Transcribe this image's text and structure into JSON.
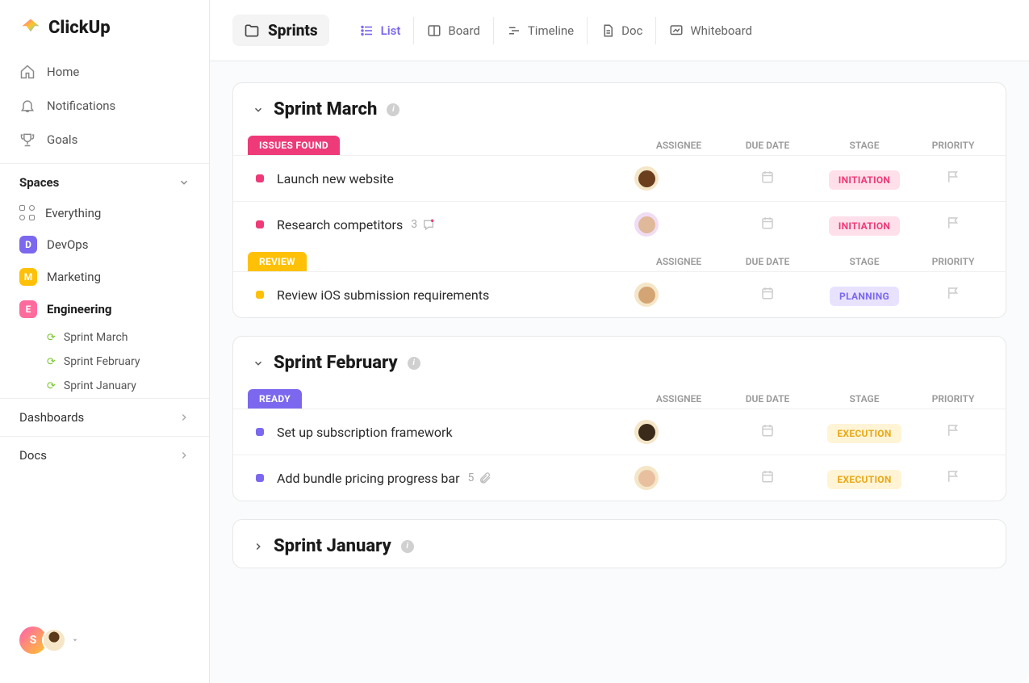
{
  "brand": "ClickUp",
  "nav": {
    "home": "Home",
    "notifications": "Notifications",
    "goals": "Goals"
  },
  "spaces": {
    "header": "Spaces",
    "everything": "Everything",
    "items": [
      {
        "letter": "D",
        "label": "DevOps",
        "color": "#7b68ee"
      },
      {
        "letter": "M",
        "label": "Marketing",
        "color": "#ffc107"
      },
      {
        "letter": "E",
        "label": "Engineering",
        "color": "#ff6b9d"
      }
    ]
  },
  "sprint_links": [
    "Sprint  March",
    "Sprint  February",
    "Sprint January"
  ],
  "sections": {
    "dashboards": "Dashboards",
    "docs": "Docs"
  },
  "user_initial": "S",
  "topbar": {
    "folder": "Sprints",
    "views": [
      "List",
      "Board",
      "Timeline",
      "Doc",
      "Whiteboard"
    ]
  },
  "columns": {
    "assignee": "ASSIGNEE",
    "due": "DUE DATE",
    "stage": "STAGE",
    "priority": "PRIORITY"
  },
  "sprints": [
    {
      "title": "Sprint March",
      "expanded": true,
      "groups": [
        {
          "status": "ISSUES FOUND",
          "status_color": "#ee3a78",
          "task_color": "#ee3a78",
          "tasks": [
            {
              "title": "Launch new website",
              "stage": "INITIATION",
              "stage_bg": "#ffe0ea",
              "stage_color": "#ee3a78",
              "avatar_bg": "#f5e6c8",
              "face": "#6b3e1e"
            },
            {
              "title": "Research competitors",
              "count": "3",
              "has_chat": true,
              "stage": "INITIATION",
              "stage_bg": "#ffe0ea",
              "stage_color": "#ee3a78",
              "avatar_bg": "#f0ddf3",
              "face": "#e0b89a"
            }
          ]
        },
        {
          "status": "REVIEW",
          "status_color": "#ffc107",
          "task_color": "#ffc107",
          "tasks": [
            {
              "title": "Review iOS submission requirements",
              "stage": "PLANNING",
              "stage_bg": "#e8e2ff",
              "stage_color": "#7b68ee",
              "avatar_bg": "#f5e6c8",
              "face": "#d4a574"
            }
          ]
        }
      ]
    },
    {
      "title": "Sprint February",
      "expanded": true,
      "groups": [
        {
          "status": "READY",
          "status_color": "#7b68ee",
          "task_color": "#7b68ee",
          "tasks": [
            {
              "title": "Set up subscription framework",
              "stage": "EXECUTION",
              "stage_bg": "#fff4d6",
              "stage_color": "#e8a817",
              "avatar_bg": "#f5e6c8",
              "face": "#3a2a1a"
            },
            {
              "title": "Add bundle pricing progress bar",
              "count": "5",
              "has_attach": true,
              "stage": "EXECUTION",
              "stage_bg": "#fff4d6",
              "stage_color": "#e8a817",
              "avatar_bg": "#f5e6c8",
              "face": "#e8c0a0"
            }
          ]
        }
      ]
    },
    {
      "title": "Sprint January",
      "expanded": false,
      "groups": []
    }
  ]
}
